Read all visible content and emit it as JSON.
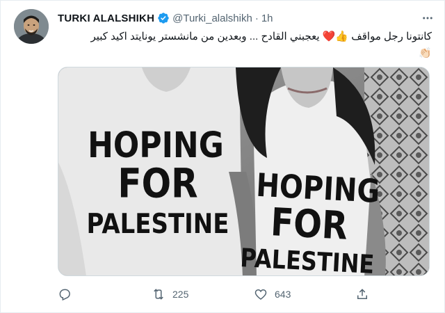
{
  "tweet": {
    "display_name": "TURKI ALALSHIKH",
    "handle": "@Turki_alalshikh",
    "separator": "·",
    "time": "1h",
    "text_line1": "كانتونا رجل مواقف 👍❤️ يعجبني القادح ... وبعدين من مانشستر يونايتد اكيد كبير",
    "text_line2": "👏🏻",
    "image_shirt_text_left": [
      "HOPING",
      "FOR",
      "PALESTINE"
    ],
    "image_shirt_text_right": [
      "HOPING",
      "FOR",
      "PALESTINE"
    ]
  },
  "actions": {
    "reply_icon": "reply-icon",
    "retweet_count": "225",
    "like_count": "643",
    "share_icon": "share-icon"
  },
  "colors": {
    "verified": "#1d9bf0",
    "secondary_text": "#536471",
    "border": "#cfd9de"
  }
}
